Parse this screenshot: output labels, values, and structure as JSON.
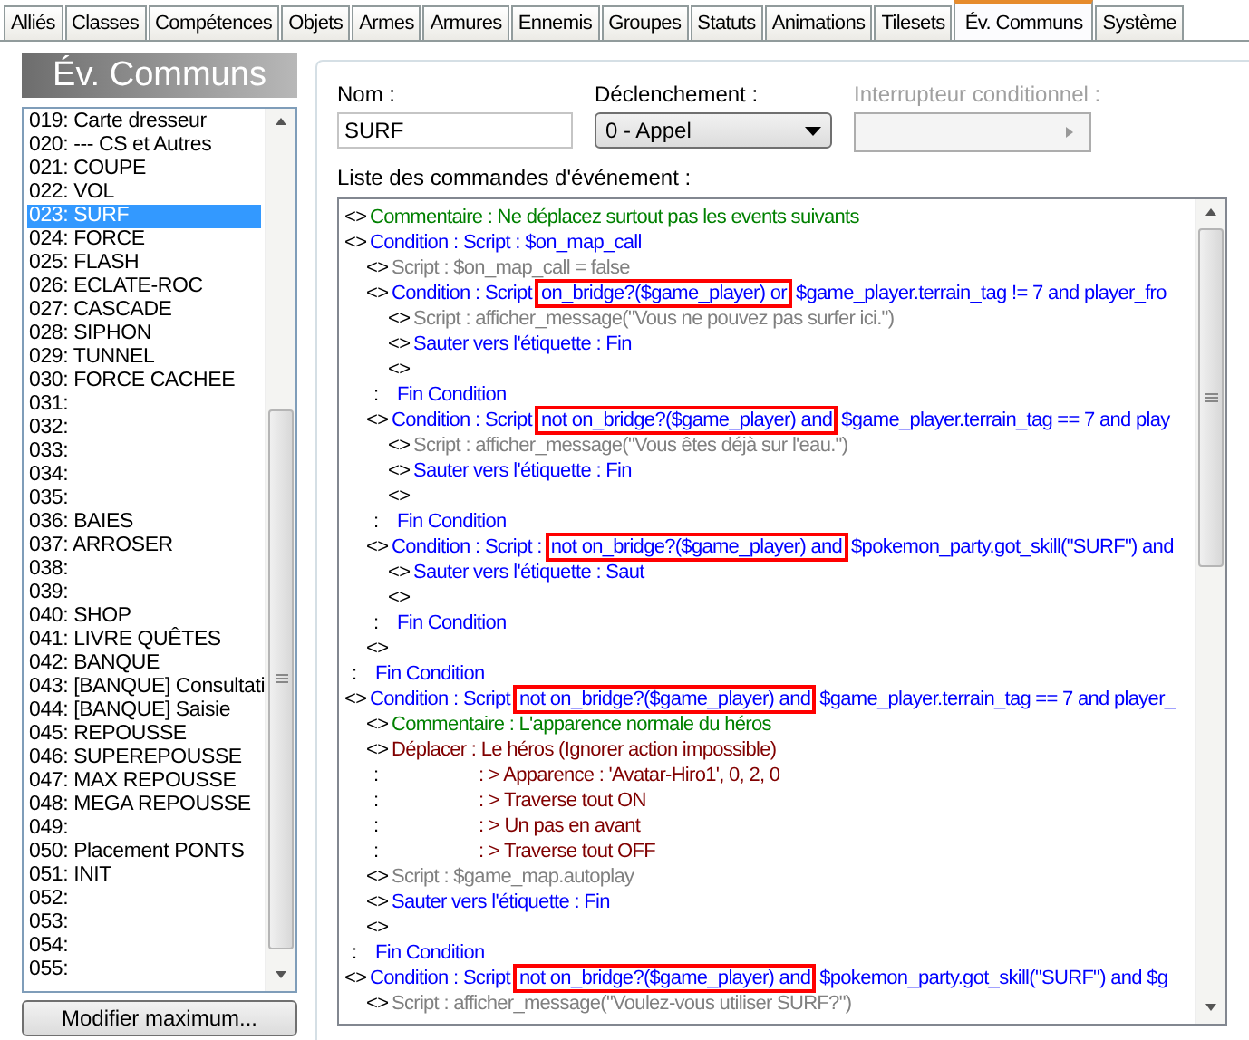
{
  "tabs": [
    {
      "label": "Alliés",
      "selected": false
    },
    {
      "label": "Classes",
      "selected": false
    },
    {
      "label": "Compétences",
      "selected": false
    },
    {
      "label": "Objets",
      "selected": false
    },
    {
      "label": "Armes",
      "selected": false
    },
    {
      "label": "Armures",
      "selected": false
    },
    {
      "label": "Ennemis",
      "selected": false
    },
    {
      "label": "Groupes",
      "selected": false
    },
    {
      "label": "Statuts",
      "selected": false
    },
    {
      "label": "Animations",
      "selected": false
    },
    {
      "label": "Tilesets",
      "selected": false
    },
    {
      "label": "Év. Communs",
      "selected": true
    },
    {
      "label": "Système",
      "selected": false
    }
  ],
  "sidebar": {
    "title": "Év. Communs",
    "button": "Modifier maximum...",
    "items": [
      {
        "label": "019: Carte dresseur",
        "selected": false
      },
      {
        "label": "020: --- CS et Autres",
        "selected": false
      },
      {
        "label": "021: COUPE",
        "selected": false
      },
      {
        "label": "022: VOL",
        "selected": false
      },
      {
        "label": "023: SURF",
        "selected": true
      },
      {
        "label": "024: FORCE",
        "selected": false
      },
      {
        "label": "025: FLASH",
        "selected": false
      },
      {
        "label": "026: ECLATE-ROC",
        "selected": false
      },
      {
        "label": "027: CASCADE",
        "selected": false
      },
      {
        "label": "028: SIPHON",
        "selected": false
      },
      {
        "label": "029: TUNNEL",
        "selected": false
      },
      {
        "label": "030: FORCE CACHEE",
        "selected": false
      },
      {
        "label": "031:",
        "selected": false
      },
      {
        "label": "032:",
        "selected": false
      },
      {
        "label": "033:",
        "selected": false
      },
      {
        "label": "034:",
        "selected": false
      },
      {
        "label": "035:",
        "selected": false
      },
      {
        "label": "036: BAIES",
        "selected": false
      },
      {
        "label": "037: ARROSER",
        "selected": false
      },
      {
        "label": "038:",
        "selected": false
      },
      {
        "label": "039:",
        "selected": false
      },
      {
        "label": "040: SHOP",
        "selected": false
      },
      {
        "label": "041: LIVRE QUÊTES",
        "selected": false
      },
      {
        "label": "042: BANQUE",
        "selected": false
      },
      {
        "label": "043: [BANQUE] Consultati",
        "selected": false
      },
      {
        "label": "044: [BANQUE] Saisie",
        "selected": false
      },
      {
        "label": "045: REPOUSSE",
        "selected": false
      },
      {
        "label": "046: SUPEREPOUSSE",
        "selected": false
      },
      {
        "label": "047: MAX REPOUSSE",
        "selected": false
      },
      {
        "label": "048: MEGA REPOUSSE",
        "selected": false
      },
      {
        "label": "049:",
        "selected": false
      },
      {
        "label": "050: Placement PONTS",
        "selected": false
      },
      {
        "label": "051: INIT",
        "selected": false
      },
      {
        "label": "052:",
        "selected": false
      },
      {
        "label": "053:",
        "selected": false
      },
      {
        "label": "054:",
        "selected": false
      },
      {
        "label": "055:",
        "selected": false
      }
    ]
  },
  "name_field": {
    "label": "Nom :",
    "value": "SURF"
  },
  "trigger": {
    "label": "Déclenchement :",
    "value": "0 - Appel"
  },
  "switch": {
    "label": "Interrupteur conditionnel :",
    "disabled": true
  },
  "commands": {
    "label": "Liste des commandes d'événement :",
    "lines": [
      {
        "marker": "<>",
        "kind": "comment",
        "text": "Commentaire : Ne déplacez surtout pas les events suivants"
      },
      {
        "marker": "<>",
        "kind": "flow",
        "text": "Condition : Script : $on_map_call",
        "children": [
          {
            "marker": "<>",
            "kind": "script",
            "text": "Script : $on_map_call = false"
          },
          {
            "marker": "<>",
            "kind": "flow",
            "text": "Condition : Script",
            "highlight": "on_bridge?($game_player) or",
            "rest": "$game_player.terrain_tag != 7 and player_fro",
            "children": [
              {
                "marker": "<>",
                "kind": "script",
                "text": "Script : afficher_message(\"Vous ne pouvez pas surfer ici.\")"
              },
              {
                "marker": "<>",
                "kind": "flow",
                "text": "Sauter vers l'étiquette : Fin"
              },
              {
                "marker": "<>"
              }
            ]
          },
          {
            "marker": ":",
            "kind": "flow",
            "text": "Fin Condition"
          },
          {
            "marker": "<>",
            "kind": "flow",
            "text": "Condition : Script",
            "highlight": "not on_bridge?($game_player) and",
            "rest": "$game_player.terrain_tag == 7 and play",
            "children": [
              {
                "marker": "<>",
                "kind": "script",
                "text": "Script : afficher_message(\"Vous êtes déjà sur l'eau.\")"
              },
              {
                "marker": "<>",
                "kind": "flow",
                "text": "Sauter vers l'étiquette : Fin"
              },
              {
                "marker": "<>"
              }
            ]
          },
          {
            "marker": ":",
            "kind": "flow",
            "text": "Fin Condition"
          },
          {
            "marker": "<>",
            "kind": "flow",
            "text": "Condition : Script :",
            "highlight": "not on_bridge?($game_player) and",
            "rest": "$pokemon_party.got_skill(\"SURF\") and",
            "children": [
              {
                "marker": "<>",
                "kind": "flow",
                "text": "Sauter vers l'étiquette : Saut"
              },
              {
                "marker": "<>"
              }
            ]
          },
          {
            "marker": ":",
            "kind": "flow",
            "text": "Fin Condition"
          },
          {
            "marker": "<>"
          }
        ]
      },
      {
        "marker": ":",
        "kind": "flow",
        "text": "Fin Condition"
      },
      {
        "marker": "<>",
        "kind": "flow",
        "text": "Condition : Script",
        "highlight": "not on_bridge?($game_player) and",
        "rest": "$game_player.terrain_tag == 7 and player_",
        "children": [
          {
            "marker": "<>",
            "kind": "comment",
            "text": "Commentaire : L'apparence normale du héros"
          },
          {
            "marker": "<>",
            "kind": "move",
            "text": "Déplacer : Le héros (Ignorer action impossible)"
          },
          {
            "marker": ":",
            "kind": "step",
            "text": ": > Apparence : 'Avatar-Hiro1', 0, 2, 0"
          },
          {
            "marker": ":",
            "kind": "step",
            "text": ": > Traverse tout ON"
          },
          {
            "marker": ":",
            "kind": "step",
            "text": ": > Un pas en avant"
          },
          {
            "marker": ":",
            "kind": "step",
            "text": ": > Traverse tout OFF"
          },
          {
            "marker": "<>",
            "kind": "script",
            "text": "Script : $game_map.autoplay"
          },
          {
            "marker": "<>",
            "kind": "flow",
            "text": "Sauter vers l'étiquette : Fin"
          },
          {
            "marker": "<>"
          }
        ]
      },
      {
        "marker": ":",
        "kind": "flow",
        "text": "Fin Condition"
      },
      {
        "marker": "<>",
        "kind": "flow",
        "text": "Condition : Script",
        "highlight": "not on_bridge?($game_player) and",
        "rest": "$pokemon_party.got_skill(\"SURF\") and $g",
        "children": [
          {
            "marker": "<>",
            "kind": "script",
            "text": "Script : afficher_message(\"Voulez-vous utiliser SURF?\")"
          }
        ]
      }
    ]
  }
}
